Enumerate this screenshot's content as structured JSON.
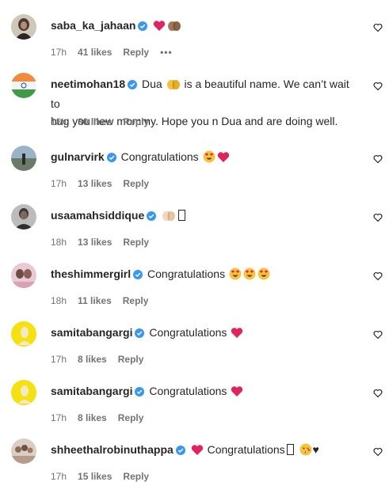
{
  "comments": [
    {
      "username": "saba_ka_jahaan",
      "verified": true,
      "text": "",
      "emojis": [
        "red-heart-emoji",
        "praying-hands-emoji"
      ],
      "time": "17h",
      "likes": "41 likes",
      "reply": "Reply",
      "more": "•••"
    },
    {
      "username": "neetimohan18",
      "verified": true,
      "text_line1": "Dua ",
      "text_after_emoji": " is a beautiful name. We can’t wait to",
      "text_line2": "hug you new mommy. Hope you n Dua and are doing well.",
      "time": "18h",
      "likes": "30 likes",
      "reply": "Reply"
    },
    {
      "username": "gulnarvirk",
      "verified": true,
      "text": "Congratulations",
      "emojis": [
        "heart-eyes-emoji",
        "red-heart-emoji"
      ],
      "time": "17h",
      "likes": "13 likes",
      "reply": "Reply"
    },
    {
      "username": "usaamahsiddique",
      "verified": true,
      "text": "",
      "emojis": [
        "praying-hands-emoji"
      ],
      "tail": "",
      "time": "18h",
      "likes": "13 likes",
      "reply": "Reply"
    },
    {
      "username": "theshimmergirl",
      "verified": true,
      "text": "Congratulations",
      "emojis": [
        "heart-eyes-emoji",
        "heart-eyes-emoji",
        "heart-eyes-emoji"
      ],
      "time": "18h",
      "likes": "11 likes",
      "reply": "Reply"
    },
    {
      "username": "samitabangargi",
      "verified": true,
      "text": "Congratulations",
      "emojis": [
        "red-heart-emoji"
      ],
      "time": "17h",
      "likes": "8 likes",
      "reply": "Reply"
    },
    {
      "username": "samitabangargi",
      "verified": true,
      "text": "Congratulations",
      "emojis": [
        "red-heart-emoji"
      ],
      "time": "17h",
      "likes": "8 likes",
      "reply": "Reply"
    },
    {
      "username": "shheethalrobinuthappa",
      "verified": true,
      "text": "Congratulations",
      "small_heart": "♥",
      "time": "17h",
      "likes": "15 likes",
      "reply": "Reply"
    }
  ],
  "colors": {
    "verified": "#3897f0",
    "text": "#262626",
    "meta": "#737373",
    "heart_red": "#e0245e"
  }
}
